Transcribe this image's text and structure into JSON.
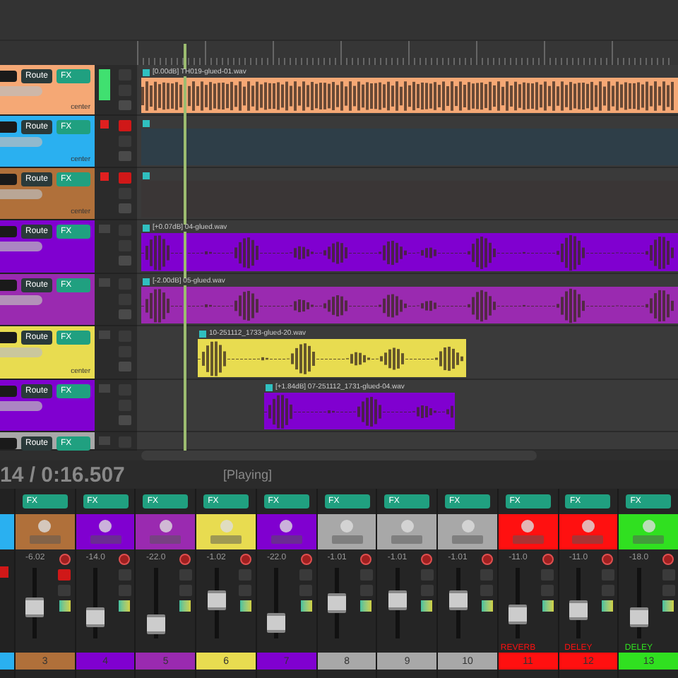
{
  "tracks": [
    {
      "color": "#f5a875",
      "muted": false,
      "route": "Route",
      "fx": "FX",
      "pan_label": "center",
      "item": {
        "name": "[0.00dB] TH019-glued-01.wav",
        "color": "#f5a875"
      }
    },
    {
      "color": "#2ab0f0",
      "muted": true,
      "route": "Route",
      "fx": "FX",
      "pan_label": "center",
      "item": {
        "color": "#2e3e48"
      }
    },
    {
      "color": "#b0703a",
      "muted": true,
      "route": "Route",
      "fx": "FX",
      "pan_label": "center",
      "item": {
        "color": "#3a3636"
      }
    },
    {
      "color": "#8000d0",
      "muted": false,
      "route": "Route",
      "fx": "FX",
      "item": {
        "name": "[+0.07dB] 04-glued.wav",
        "color": "#8000d0"
      }
    },
    {
      "color": "#9a2ab0",
      "muted": false,
      "route": "Route",
      "fx": "FX",
      "item": {
        "name": "[-2.00dB] 05-glued.wav",
        "color": "#9a2ab0"
      }
    },
    {
      "color": "#e8dc50",
      "muted": false,
      "route": "Route",
      "fx": "FX",
      "pan_label": "center",
      "item": {
        "name": "10-251112_1733-glued-20.wav",
        "color": "#e8dc50"
      }
    },
    {
      "color": "#8000d0",
      "muted": false,
      "route": "Route",
      "fx": "FX",
      "item": {
        "name": "[+1.84dB] 07-251112_1731-glued-04.wav",
        "color": "#8000d0"
      }
    },
    {
      "color": "#a8a8a8",
      "muted": false,
      "route": "Route",
      "fx": "FX"
    }
  ],
  "transport": {
    "time": "14 / 0:16.507",
    "state": "[Playing]"
  },
  "mixer": [
    {
      "kind": "partial",
      "color": "#2ab0f0",
      "muted": true
    },
    {
      "kind": "full",
      "number": "3",
      "color": "#b0703a",
      "volume": "-6.02",
      "muted": true,
      "level": 0.45,
      "fx": "FX"
    },
    {
      "kind": "full",
      "number": "4",
      "color": "#8000d0",
      "volume": "-14.0",
      "muted": false,
      "level": 0.3,
      "fx": "FX"
    },
    {
      "kind": "full",
      "number": "5",
      "color": "#9a2ab0",
      "volume": "-22.0",
      "muted": false,
      "level": 0.2,
      "fx": "FX"
    },
    {
      "kind": "full",
      "number": "6",
      "color": "#e8dc50",
      "volume": "-1.02",
      "muted": false,
      "level": 0.55,
      "fx": "FX"
    },
    {
      "kind": "full",
      "number": "7",
      "color": "#8000d0",
      "volume": "-22.0",
      "muted": false,
      "level": 0.22,
      "fx": "FX"
    },
    {
      "kind": "full",
      "number": "8",
      "color": "#a8a8a8",
      "volume": "-1.01",
      "muted": false,
      "level": 0.5,
      "fx": "FX"
    },
    {
      "kind": "full",
      "number": "9",
      "color": "#a8a8a8",
      "volume": "-1.01",
      "muted": false,
      "level": 0.55,
      "fx": "FX"
    },
    {
      "kind": "full",
      "number": "10",
      "color": "#a8a8a8",
      "volume": "-1.01",
      "muted": false,
      "level": 0.55,
      "fx": "FX"
    },
    {
      "kind": "full",
      "number": "11",
      "color": "#ff1010",
      "name": "REVERB",
      "volume": "-11.0",
      "muted": false,
      "level": 0.35,
      "fx": "FX"
    },
    {
      "kind": "full",
      "number": "12",
      "color": "#ff1010",
      "name": "DELEY",
      "volume": "-11.0",
      "muted": false,
      "level": 0.4,
      "fx": "FX"
    },
    {
      "kind": "full",
      "number": "13",
      "color": "#30e020",
      "name": "DELEY",
      "volume": "-18.0",
      "muted": false,
      "level": 0.3,
      "fx": "FX"
    }
  ]
}
